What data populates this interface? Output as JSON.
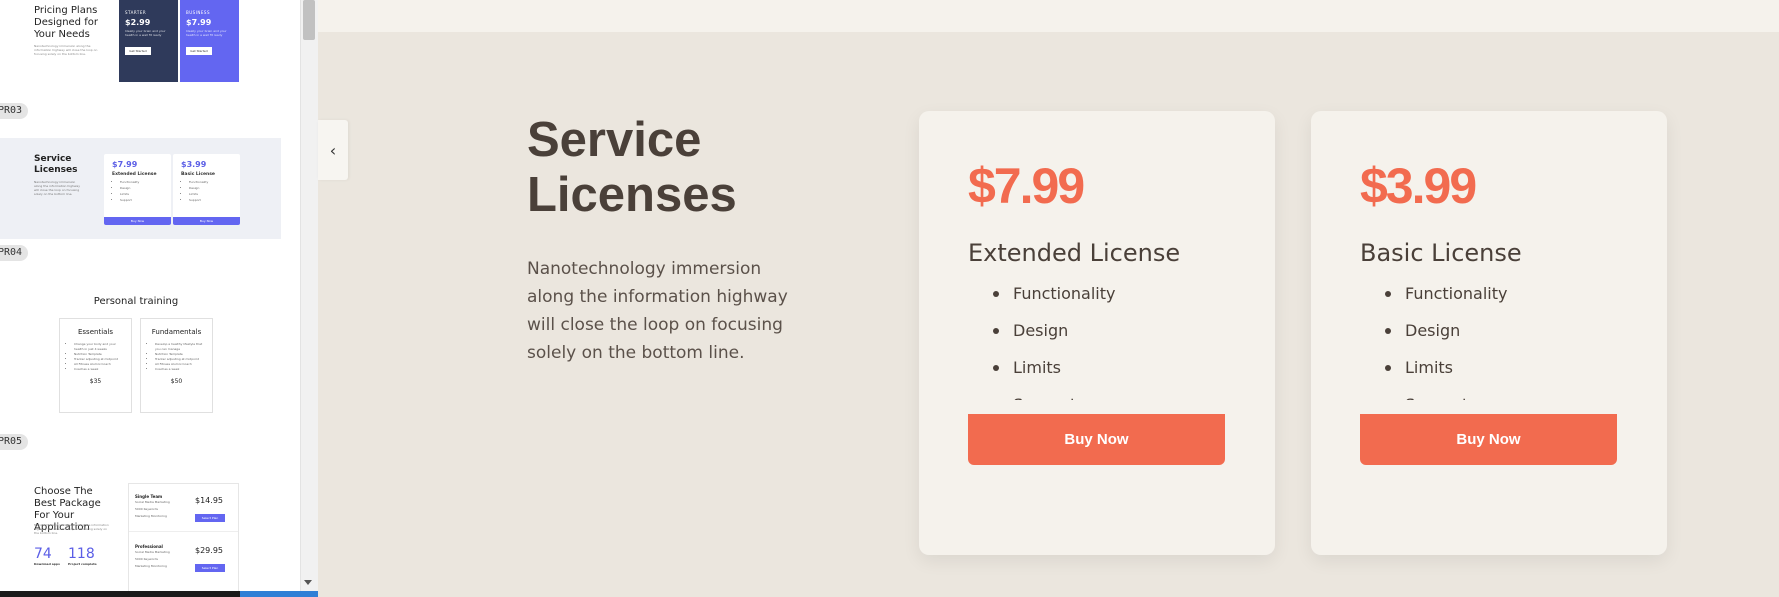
{
  "sidebar": {
    "tags": [
      "PR03",
      "PR04",
      "PR05"
    ],
    "thumb1": {
      "title": "Pricing Plans Designed for Your Needs",
      "desc": "Nanotechnology immersion along the information highway will close the loop on focusing solely on the bottom line.",
      "cards": [
        {
          "label": "STARTER",
          "price": "$2.99",
          "text": "Ideally your brain and your health in a well fit ready",
          "button": "Get Started"
        },
        {
          "label": "BUSINESS",
          "price": "$7.99",
          "text": "Ideally your brain and your health in a well fit ready",
          "button": "Get Started"
        }
      ]
    },
    "thumb2": {
      "title": "Service Licenses",
      "desc": "Nanotechnology immersion along the information highway will close the loop on focusing solely on the bottom line.",
      "cards": [
        {
          "price": "$7.99",
          "name": "Extended License",
          "features": [
            "Functionality",
            "Design",
            "Limits",
            "Support"
          ],
          "button": "Buy Now"
        },
        {
          "price": "$3.99",
          "name": "Basic License",
          "features": [
            "Functionality",
            "Design",
            "Limits",
            "Support"
          ],
          "button": "Buy Now"
        }
      ]
    },
    "thumb3": {
      "title": "Personal training",
      "cards": [
        {
          "name": "Essentials",
          "features": [
            "Change your body and your health in just 4 weeks",
            "Nutrition Template",
            "Tracker adjusting at midpoint",
            "All Fitness Alumni Coach",
            "Coaches a week"
          ],
          "price": "$35"
        },
        {
          "name": "Fundamentals",
          "features": [
            "Develop a healthy lifestyle that you can manage",
            "Nutrition Template",
            "Tracker adjusting at midpoint",
            "All Fitness Alumni Coach",
            "Coaches a week"
          ],
          "price": "$50"
        }
      ]
    },
    "thumb4": {
      "title": "Choose The Best Package For Your Application",
      "desc": "Nanotechnology immersion along the information highway will close the loop on focusing solely on the bottom line.",
      "stats": [
        {
          "value": "74",
          "label": "Download apps"
        },
        {
          "value": "118",
          "label": "Project complete"
        }
      ],
      "plans": [
        {
          "name": "Single Team",
          "features": [
            "Social Media Marketing",
            "5000 Keywords",
            "Marketing Monitoring"
          ],
          "price": "$14.95",
          "button": "Select Plan"
        },
        {
          "name": "Professional",
          "features": [
            "Social Media Marketing",
            "5000 Keywords",
            "Marketing Monitoring"
          ],
          "price": "$29.95",
          "button": "Select Plan"
        }
      ]
    }
  },
  "main": {
    "heading": "Service Licenses",
    "description": "Nanotechnology immersion along the information highway will close the loop on focusing solely on the bottom line.",
    "cards": [
      {
        "price": "$7.99",
        "name": "Extended License",
        "features": [
          "Functionality",
          "Design",
          "Limits",
          "Support"
        ],
        "button": "Buy Now"
      },
      {
        "price": "$3.99",
        "name": "Basic License",
        "features": [
          "Functionality",
          "Design",
          "Limits",
          "Support"
        ],
        "button": "Buy Now"
      }
    ]
  },
  "icons": {
    "collapse": "chevron-left-icon"
  },
  "colors": {
    "accent": "#f26b4f",
    "text": "#4a4039",
    "card_bg": "#f5f2ec",
    "page_bg": "#ebe6de",
    "thumb_accent": "#6366f1"
  }
}
